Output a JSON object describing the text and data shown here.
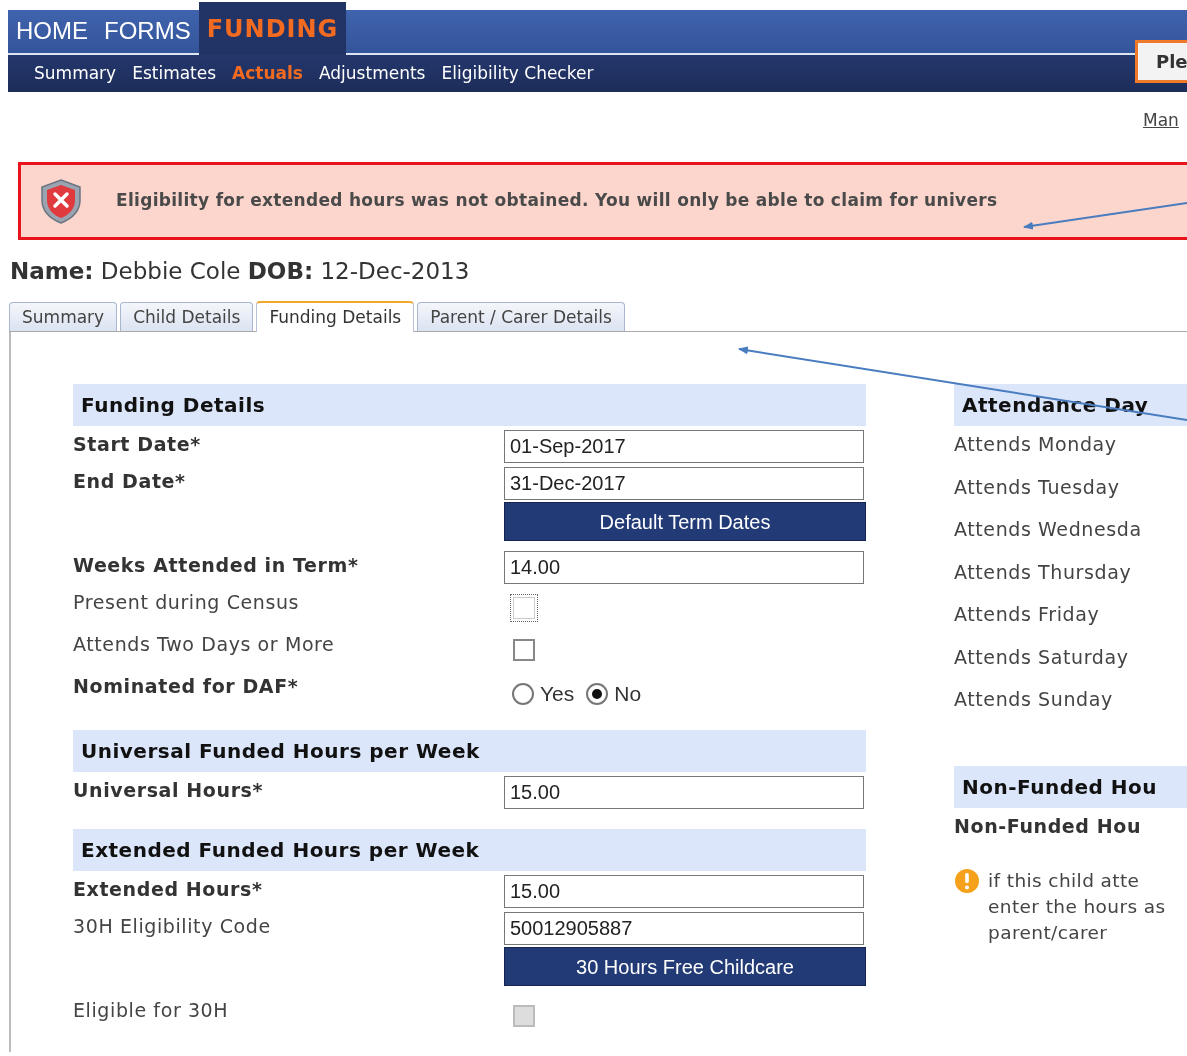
{
  "nav": {
    "main": [
      {
        "label": "HOME",
        "selected": false
      },
      {
        "label": "FORMS",
        "selected": false
      },
      {
        "label": "FUNDING",
        "selected": true
      }
    ],
    "sub": [
      {
        "label": "Summary",
        "selected": false
      },
      {
        "label": "Estimates",
        "selected": false
      },
      {
        "label": "Actuals",
        "selected": true
      },
      {
        "label": "Adjustments",
        "selected": false
      },
      {
        "label": "Eligibility Checker",
        "selected": false
      }
    ]
  },
  "top_button": "Ple",
  "top_link": "Man",
  "alert": {
    "message": "Eligibility for extended hours was not obtained. You will only be able to claim for univers"
  },
  "child_line": "**Name:** Debbie Cole **DOB:** 12-Dec-2013",
  "tabs": [
    {
      "label": "Summary",
      "selected": false
    },
    {
      "label": "Child Details",
      "selected": false
    },
    {
      "label": "Funding Details",
      "selected": true
    },
    {
      "label": "Parent / Carer Details",
      "selected": false
    }
  ],
  "left_sections": [
    {
      "title": "Funding Details",
      "rows": [
        {
          "kind": "input",
          "label": "Start Date*",
          "bold": true,
          "value": "01-Sep-2017"
        },
        {
          "kind": "input",
          "label": "End Date*",
          "bold": true,
          "value": "31-Dec-2017"
        },
        {
          "kind": "button",
          "text": "Default Term Dates"
        },
        {
          "kind": "input",
          "label": "Weeks Attended in Term*",
          "bold": true,
          "value": "14.00"
        },
        {
          "kind": "checkbox",
          "label": "Present during Census",
          "bold": false,
          "checked": false,
          "focused": true,
          "disabled": false
        },
        {
          "kind": "checkbox",
          "label": "Attends Two Days or More",
          "bold": false,
          "checked": false,
          "focused": false,
          "disabled": false
        },
        {
          "kind": "radio",
          "label": "Nominated for DAF*",
          "bold": true,
          "options": [
            {
              "label": "Yes",
              "selected": false
            },
            {
              "label": "No",
              "selected": true
            }
          ]
        }
      ]
    },
    {
      "title": "Universal Funded Hours per Week",
      "rows": [
        {
          "kind": "input",
          "label": "Universal Hours*",
          "bold": true,
          "value": "15.00"
        }
      ]
    },
    {
      "title": "Extended Funded Hours per Week",
      "rows": [
        {
          "kind": "input",
          "label": "Extended Hours*",
          "bold": true,
          "value": "15.00"
        },
        {
          "kind": "input",
          "label": "30H Eligibility Code",
          "bold": false,
          "value": "50012905887"
        },
        {
          "kind": "button",
          "text": "30 Hours Free Childcare"
        },
        {
          "kind": "checkbox",
          "label": "Eligible for 30H",
          "bold": false,
          "checked": false,
          "focused": false,
          "disabled": true
        }
      ]
    }
  ],
  "right_sections": [
    {
      "title": "Attendance Day",
      "rows": [
        {
          "kind": "text",
          "label": "Attends Monday",
          "bold": false
        },
        {
          "kind": "text",
          "label": "Attends Tuesday",
          "bold": false
        },
        {
          "kind": "text",
          "label": "Attends Wednesda",
          "bold": false
        },
        {
          "kind": "text",
          "label": "Attends Thursday",
          "bold": false
        },
        {
          "kind": "text",
          "label": "Attends Friday",
          "bold": false
        },
        {
          "kind": "text",
          "label": "Attends Saturday",
          "bold": false
        },
        {
          "kind": "text",
          "label": "Attends Sunday",
          "bold": false
        }
      ]
    },
    {
      "title": "Non-Funded Hou",
      "rows": [
        {
          "kind": "text",
          "label": "Non-Funded Hou",
          "bold": true
        },
        {
          "kind": "note",
          "lines": [
            "if this child atte",
            "enter the hours as",
            "parent/carer"
          ]
        }
      ]
    }
  ]
}
